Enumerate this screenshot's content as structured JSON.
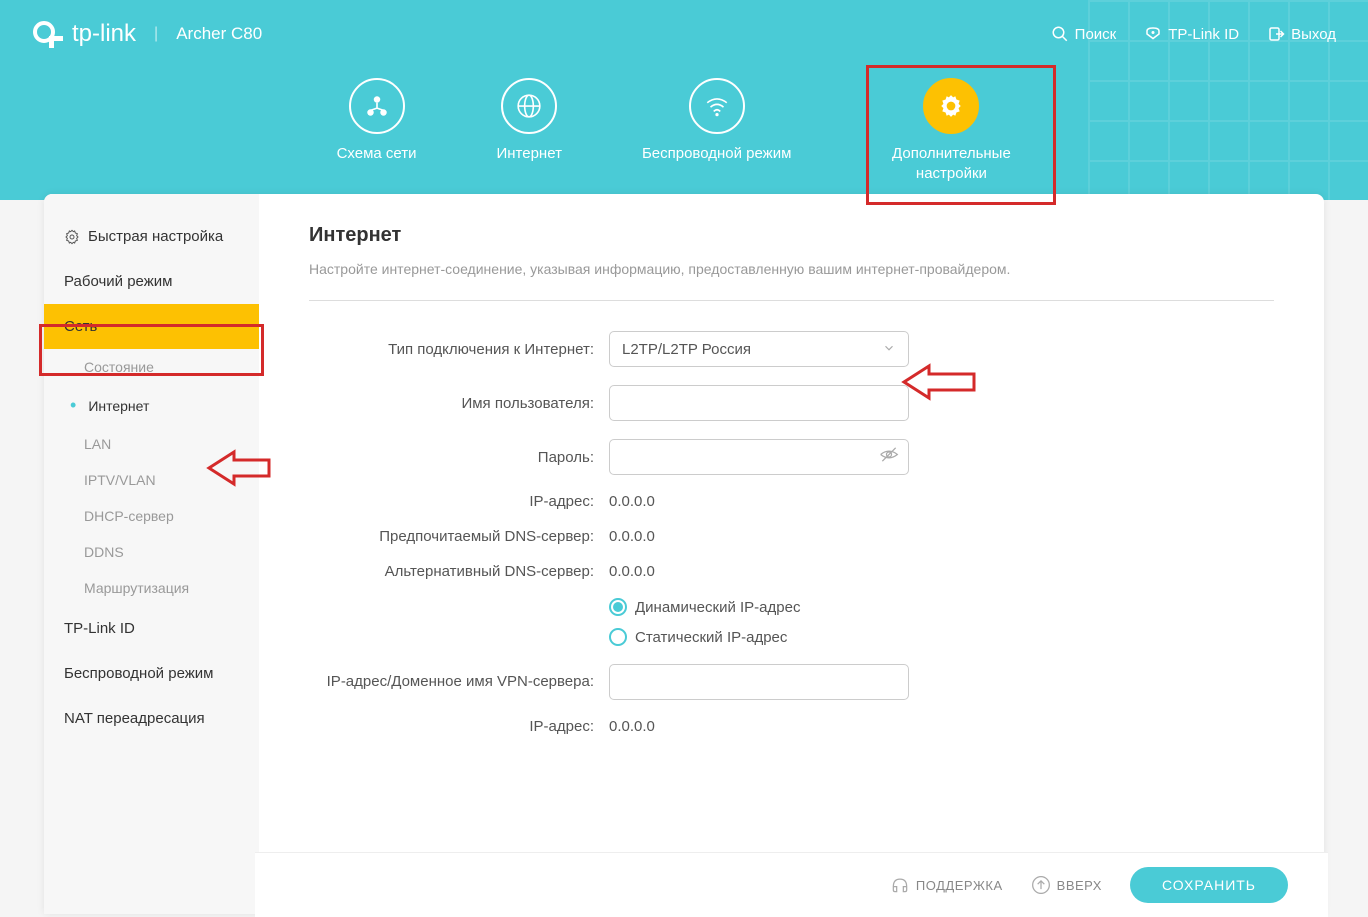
{
  "header": {
    "brand": "tp-link",
    "model": "Archer C80",
    "actions": {
      "search": "Поиск",
      "tplinkid": "TP-Link ID",
      "logout": "Выход"
    }
  },
  "navtabs": [
    {
      "label": "Схема сети"
    },
    {
      "label": "Интернет"
    },
    {
      "label": "Беспроводной режим"
    },
    {
      "label": "Дополнительные настройки"
    }
  ],
  "sidebar": {
    "items": [
      {
        "label": "Быстрая настройка"
      },
      {
        "label": "Рабочий режим"
      },
      {
        "label": "Сеть"
      },
      {
        "label": "TP-Link ID"
      },
      {
        "label": "Беспроводной режим"
      },
      {
        "label": "NAT переадресация"
      }
    ],
    "subitems": [
      {
        "label": "Состояние"
      },
      {
        "label": "Интернет"
      },
      {
        "label": "LAN"
      },
      {
        "label": "IPTV/VLAN"
      },
      {
        "label": "DHCP-сервер"
      },
      {
        "label": "DDNS"
      },
      {
        "label": "Маршрутизация"
      }
    ]
  },
  "main": {
    "title": "Интернет",
    "description": "Настройте интернет-соединение, указывая информацию, предоставленную вашим интернет-провайдером.",
    "form": {
      "conn_type_label": "Тип подключения к Интернет:",
      "conn_type_value": "L2TP/L2TP Россия",
      "username_label": "Имя пользователя:",
      "username_value": "",
      "password_label": "Пароль:",
      "password_value": "",
      "ip_label": "IP-адрес:",
      "ip_value": "0.0.0.0",
      "dns1_label": "Предпочитаемый DNS-сервер:",
      "dns1_value": "0.0.0.0",
      "dns2_label": "Альтернативный DNS-сервер:",
      "dns2_value": "0.0.0.0",
      "radio_dynamic": "Динамический IP-адрес",
      "radio_static": "Статический IP-адрес",
      "vpn_label": "IP-адрес/Доменное имя VPN-сервера:",
      "vpn_value": "",
      "ip2_label": "IP-адрес:",
      "ip2_value": "0.0.0.0"
    }
  },
  "footer": {
    "support": "ПОДДЕРЖКА",
    "top": "ВВЕРХ",
    "save": "СОХРАНИТЬ"
  }
}
